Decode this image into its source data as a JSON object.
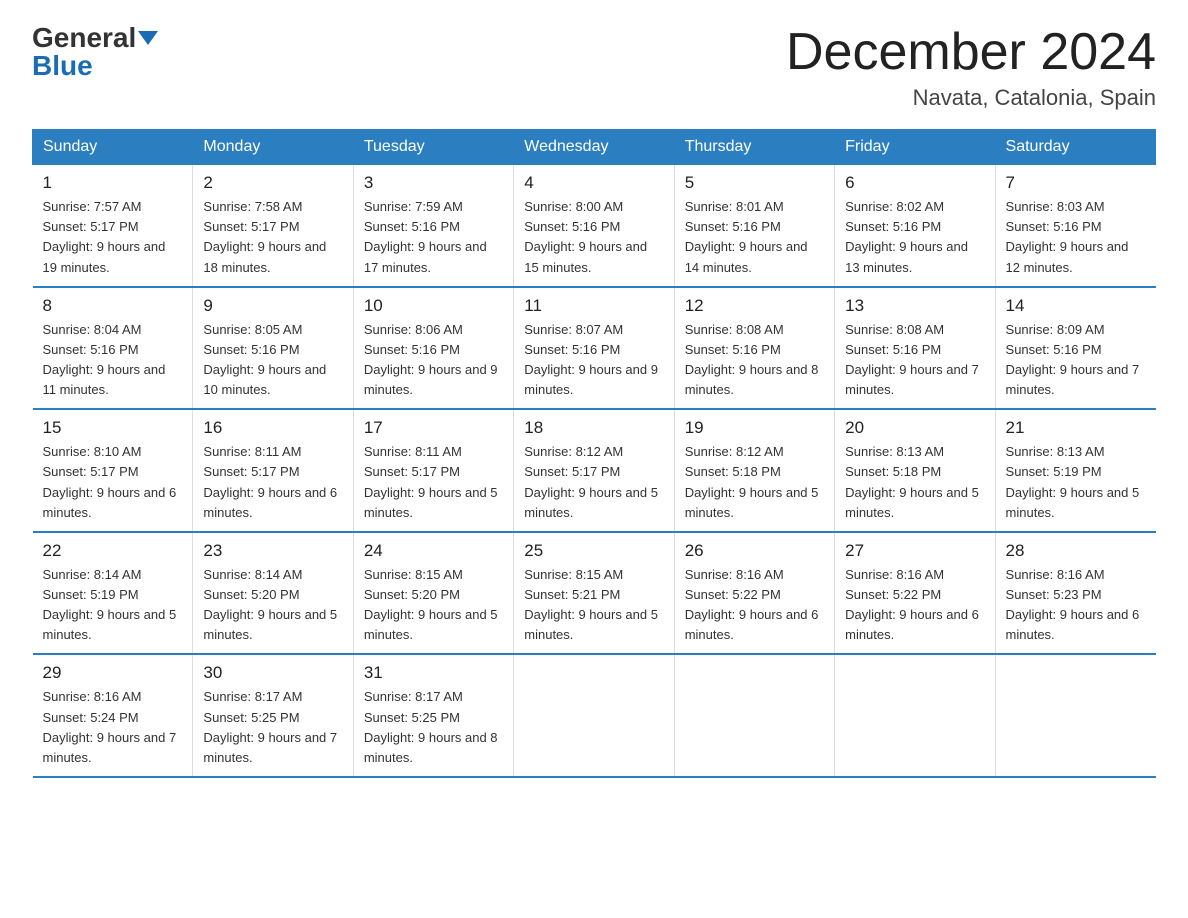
{
  "logo": {
    "general": "General",
    "blue": "Blue"
  },
  "title": "December 2024",
  "location": "Navata, Catalonia, Spain",
  "days_of_week": [
    "Sunday",
    "Monday",
    "Tuesday",
    "Wednesday",
    "Thursday",
    "Friday",
    "Saturday"
  ],
  "weeks": [
    [
      {
        "day": "1",
        "sunrise": "7:57 AM",
        "sunset": "5:17 PM",
        "daylight": "9 hours and 19 minutes."
      },
      {
        "day": "2",
        "sunrise": "7:58 AM",
        "sunset": "5:17 PM",
        "daylight": "9 hours and 18 minutes."
      },
      {
        "day": "3",
        "sunrise": "7:59 AM",
        "sunset": "5:16 PM",
        "daylight": "9 hours and 17 minutes."
      },
      {
        "day": "4",
        "sunrise": "8:00 AM",
        "sunset": "5:16 PM",
        "daylight": "9 hours and 15 minutes."
      },
      {
        "day": "5",
        "sunrise": "8:01 AM",
        "sunset": "5:16 PM",
        "daylight": "9 hours and 14 minutes."
      },
      {
        "day": "6",
        "sunrise": "8:02 AM",
        "sunset": "5:16 PM",
        "daylight": "9 hours and 13 minutes."
      },
      {
        "day": "7",
        "sunrise": "8:03 AM",
        "sunset": "5:16 PM",
        "daylight": "9 hours and 12 minutes."
      }
    ],
    [
      {
        "day": "8",
        "sunrise": "8:04 AM",
        "sunset": "5:16 PM",
        "daylight": "9 hours and 11 minutes."
      },
      {
        "day": "9",
        "sunrise": "8:05 AM",
        "sunset": "5:16 PM",
        "daylight": "9 hours and 10 minutes."
      },
      {
        "day": "10",
        "sunrise": "8:06 AM",
        "sunset": "5:16 PM",
        "daylight": "9 hours and 9 minutes."
      },
      {
        "day": "11",
        "sunrise": "8:07 AM",
        "sunset": "5:16 PM",
        "daylight": "9 hours and 9 minutes."
      },
      {
        "day": "12",
        "sunrise": "8:08 AM",
        "sunset": "5:16 PM",
        "daylight": "9 hours and 8 minutes."
      },
      {
        "day": "13",
        "sunrise": "8:08 AM",
        "sunset": "5:16 PM",
        "daylight": "9 hours and 7 minutes."
      },
      {
        "day": "14",
        "sunrise": "8:09 AM",
        "sunset": "5:16 PM",
        "daylight": "9 hours and 7 minutes."
      }
    ],
    [
      {
        "day": "15",
        "sunrise": "8:10 AM",
        "sunset": "5:17 PM",
        "daylight": "9 hours and 6 minutes."
      },
      {
        "day": "16",
        "sunrise": "8:11 AM",
        "sunset": "5:17 PM",
        "daylight": "9 hours and 6 minutes."
      },
      {
        "day": "17",
        "sunrise": "8:11 AM",
        "sunset": "5:17 PM",
        "daylight": "9 hours and 5 minutes."
      },
      {
        "day": "18",
        "sunrise": "8:12 AM",
        "sunset": "5:17 PM",
        "daylight": "9 hours and 5 minutes."
      },
      {
        "day": "19",
        "sunrise": "8:12 AM",
        "sunset": "5:18 PM",
        "daylight": "9 hours and 5 minutes."
      },
      {
        "day": "20",
        "sunrise": "8:13 AM",
        "sunset": "5:18 PM",
        "daylight": "9 hours and 5 minutes."
      },
      {
        "day": "21",
        "sunrise": "8:13 AM",
        "sunset": "5:19 PM",
        "daylight": "9 hours and 5 minutes."
      }
    ],
    [
      {
        "day": "22",
        "sunrise": "8:14 AM",
        "sunset": "5:19 PM",
        "daylight": "9 hours and 5 minutes."
      },
      {
        "day": "23",
        "sunrise": "8:14 AM",
        "sunset": "5:20 PM",
        "daylight": "9 hours and 5 minutes."
      },
      {
        "day": "24",
        "sunrise": "8:15 AM",
        "sunset": "5:20 PM",
        "daylight": "9 hours and 5 minutes."
      },
      {
        "day": "25",
        "sunrise": "8:15 AM",
        "sunset": "5:21 PM",
        "daylight": "9 hours and 5 minutes."
      },
      {
        "day": "26",
        "sunrise": "8:16 AM",
        "sunset": "5:22 PM",
        "daylight": "9 hours and 6 minutes."
      },
      {
        "day": "27",
        "sunrise": "8:16 AM",
        "sunset": "5:22 PM",
        "daylight": "9 hours and 6 minutes."
      },
      {
        "day": "28",
        "sunrise": "8:16 AM",
        "sunset": "5:23 PM",
        "daylight": "9 hours and 6 minutes."
      }
    ],
    [
      {
        "day": "29",
        "sunrise": "8:16 AM",
        "sunset": "5:24 PM",
        "daylight": "9 hours and 7 minutes."
      },
      {
        "day": "30",
        "sunrise": "8:17 AM",
        "sunset": "5:25 PM",
        "daylight": "9 hours and 7 minutes."
      },
      {
        "day": "31",
        "sunrise": "8:17 AM",
        "sunset": "5:25 PM",
        "daylight": "9 hours and 8 minutes."
      },
      null,
      null,
      null,
      null
    ]
  ]
}
